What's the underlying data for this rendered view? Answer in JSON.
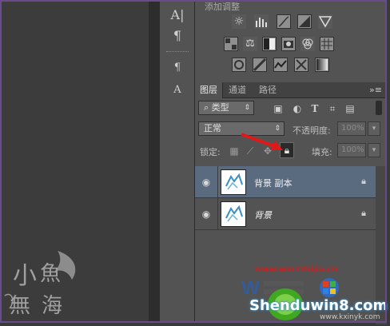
{
  "adjustments": {
    "title_partial": "添加调整",
    "icons": [
      [
        "sun-icon",
        "levels-icon",
        "curves-icon",
        "exposure-icon",
        "triangle-icon"
      ],
      [
        "vibrance-icon",
        "balance-icon",
        "bw-icon",
        "photo-filter-icon",
        "channel-mixer-icon",
        "grid-icon"
      ],
      [
        "invert-icon",
        "posterize-icon",
        "threshold-icon",
        "selective-color-icon",
        "gradient-map-icon"
      ]
    ]
  },
  "tools": [
    "A|",
    "¶",
    "¶",
    "A"
  ],
  "tabs": [
    {
      "label": "图层"
    },
    {
      "label": "通道"
    },
    {
      "label": "路径"
    }
  ],
  "filter": {
    "kind_label": "类型",
    "search_glyph": "⌕"
  },
  "blend": {
    "mode": "正常",
    "opacity_label": "不透明度:",
    "opacity_value": "100%"
  },
  "lock": {
    "label": "锁定:",
    "fill_label": "填充:",
    "fill_value": "100%"
  },
  "layers": [
    {
      "name": "背景 副本",
      "selected": true,
      "italic": false
    },
    {
      "name": "背景",
      "selected": false,
      "italic": true
    }
  ],
  "watermark": {
    "site": "www.win7zhijia.cn",
    "brand": "Shenduwin8.com",
    "sub": "www.kxinyk.com",
    "logo_chars": [
      "小",
      "魚",
      "無",
      "海"
    ]
  }
}
